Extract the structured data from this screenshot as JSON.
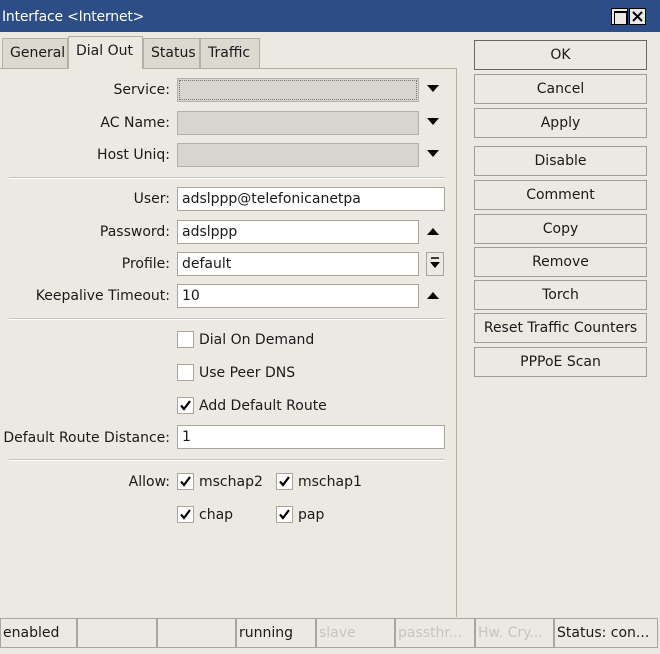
{
  "window": {
    "title": "Interface <Internet>"
  },
  "tabs": [
    {
      "label": "General"
    },
    {
      "label": "Dial Out"
    },
    {
      "label": "Status"
    },
    {
      "label": "Traffic"
    }
  ],
  "form": {
    "service": {
      "label": "Service:",
      "value": ""
    },
    "ac_name": {
      "label": "AC Name:",
      "value": ""
    },
    "host_uniq": {
      "label": "Host Uniq:",
      "value": ""
    },
    "user": {
      "label": "User:",
      "value": "adslppp@telefonicanetpa"
    },
    "password": {
      "label": "Password:",
      "value": "adslppp"
    },
    "profile": {
      "label": "Profile:",
      "value": "default"
    },
    "keepalive": {
      "label": "Keepalive Timeout:",
      "value": "10"
    },
    "dial_on_demand": {
      "label": "Dial On Demand",
      "checked": false
    },
    "use_peer_dns": {
      "label": "Use Peer DNS",
      "checked": false
    },
    "add_default_route": {
      "label": "Add Default Route",
      "checked": true
    },
    "default_route_distance": {
      "label": "Default Route Distance:",
      "value": "1"
    },
    "allow": {
      "label": "Allow:",
      "options": [
        {
          "label": "mschap2",
          "checked": true
        },
        {
          "label": "mschap1",
          "checked": true
        },
        {
          "label": "chap",
          "checked": true
        },
        {
          "label": "pap",
          "checked": true
        }
      ]
    }
  },
  "buttons": {
    "ok": "OK",
    "cancel": "Cancel",
    "apply": "Apply",
    "disable": "Disable",
    "comment": "Comment",
    "copy": "Copy",
    "remove": "Remove",
    "torch": "Torch",
    "reset_traffic_counters": "Reset Traffic Counters",
    "pppoe_scan": "PPPoE Scan"
  },
  "statusbar": {
    "enabled": "enabled",
    "cell2": "",
    "cell3": "",
    "running": "running",
    "slave": "slave",
    "passthrough": "passthr...",
    "hw_crypto": "Hw. Cry...",
    "status": "Status: con..."
  },
  "colors": {
    "titlebar": "#2c4d86",
    "window_bg": "#ece9e3",
    "dim_text": "#c8c5be"
  }
}
